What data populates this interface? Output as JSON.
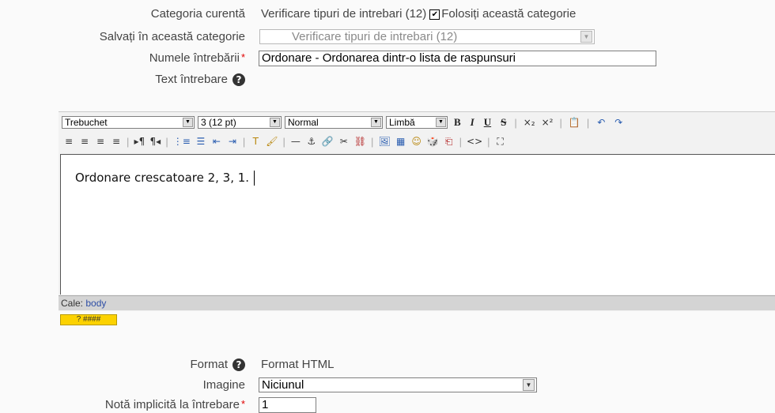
{
  "form": {
    "current_category": {
      "label": "Categoria curentă",
      "value": "Verificare tipuri de intrebari (12)",
      "checkbox_label": "Folosiți această categorie",
      "checkbox_checked": true
    },
    "save_category": {
      "label": "Salvați în această categorie",
      "value": "Verificare tipuri de intrebari (12)"
    },
    "question_name": {
      "label": "Numele întrebării",
      "value": "Ordonare - Ordonarea dintr-o lista de raspunsuri"
    },
    "question_text": {
      "label": "Text întrebare"
    },
    "format": {
      "label": "Format",
      "value": "Format HTML"
    },
    "image": {
      "label": "Imagine",
      "value": "Niciunul"
    },
    "default_grade": {
      "label": "Notă implicită la întrebare",
      "value": "1"
    }
  },
  "editor": {
    "font_family": "Trebuchet",
    "font_size": "3 (12 pt)",
    "paragraph": "Normal",
    "language": "Limbă",
    "content": "Ordonare crescatoare 2, 3, 1.",
    "path_label": "Cale:",
    "path_value": "body",
    "toolbar1": [
      "B",
      "I",
      "U",
      "S",
      "×₂",
      "×²",
      "📋",
      "↶",
      "↷"
    ],
    "toolbar2": [
      "≡",
      "≡",
      "≡",
      "≡",
      "▸¶",
      "¶◂",
      "⋮≡",
      "☰",
      "⇤",
      "⇥",
      "T",
      "🖌",
      "—",
      "⚓",
      "🔗",
      "✂",
      "⛓",
      "🖼",
      "▦",
      "☺",
      "🎲",
      "⎗",
      "<>",
      "⛶"
    ],
    "keyboard_badge": "? ####"
  },
  "icons": {
    "help": "help-icon",
    "checkbox": "checkbox-icon",
    "dropdown": "dropdown-arrow-icon"
  }
}
